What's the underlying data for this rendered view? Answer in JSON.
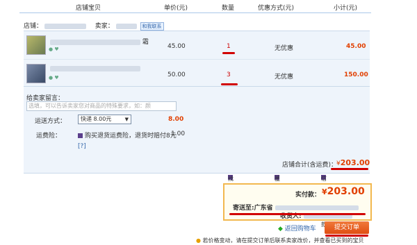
{
  "header": {
    "col_item": "店铺宝贝",
    "col_price": "单价(元)",
    "col_qty": "数量",
    "col_discount": "优惠方式(元)",
    "col_subtotal": "小计(元)"
  },
  "shop": {
    "shop_label": "店铺：",
    "seller_label": "卖家：",
    "contact_badge": "和我联系"
  },
  "items": [
    {
      "title_tail": "霜",
      "price": "45.00",
      "qty": "1",
      "discount": "无优惠",
      "subtotal": "45.00"
    },
    {
      "title_tail": "",
      "price": "50.00",
      "qty": "3",
      "discount": "无优惠",
      "subtotal": "150.00"
    }
  ],
  "message": {
    "label": "给卖家留言：",
    "placeholder": "选填，可以告诉卖家您对商品的特殊要求，如：颜"
  },
  "shipping": {
    "label": "运送方式：",
    "selected": "快递 8.00元",
    "cost": "8.00"
  },
  "insurance": {
    "label": "运费险：",
    "option_text": "购买退货运费险，退货时赔付8元",
    "option_price": "1.00",
    "help": "[?]"
  },
  "shop_total": {
    "label": "店铺合计(含运费)：",
    "currency": "¥",
    "value": "203.00"
  },
  "options": {
    "pay_for_me": "找人代付",
    "anonymous": "匿名购买",
    "installment": "信用卡分期付款"
  },
  "pay": {
    "label": "实付款：",
    "currency": "¥",
    "value": "203.00",
    "ship_to_label": "寄送至:",
    "ship_to_province": "广东省",
    "receiver_label": "收货人:"
  },
  "actions": {
    "back_to_cart": "返回购物车",
    "submit": "提交订单"
  },
  "footer": {
    "notice": "若价格变动，请在提交订单后联系卖家改价，并查看已买到的宝贝"
  },
  "colors": {
    "accent_red": "#e13f00",
    "annotation_red": "#d10000",
    "submit_orange": "#e65a1f",
    "panel_blue": "#eef4fb"
  }
}
